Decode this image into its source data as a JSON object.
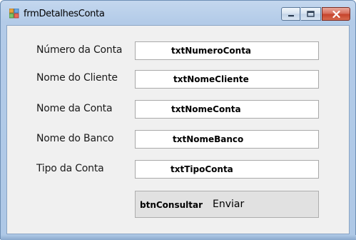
{
  "window": {
    "title": "frmDetalhesConta",
    "icon": "windows-form-icon",
    "controls": {
      "minimize": "minimize-icon",
      "maximize": "maximize-icon",
      "close": "close-icon"
    }
  },
  "form": {
    "fields": [
      {
        "label": "Número da Conta",
        "control_name": "txtNumeroConta"
      },
      {
        "label": "Nome do Cliente",
        "control_name": "txtNomeCliente"
      },
      {
        "label": "Nome da Conta",
        "control_name": "txtNomeConta"
      },
      {
        "label": "Nome do Banco",
        "control_name": "txtNomeBanco"
      },
      {
        "label": "Tipo da Conta",
        "control_name": "txtTipoConta"
      }
    ],
    "submit": {
      "control_name": "btnConsultar",
      "label": "Enviar"
    }
  },
  "colors": {
    "titlebar": "#b9d1ea",
    "client_background": "#f0f0f0",
    "close_button": "#c6442c"
  }
}
